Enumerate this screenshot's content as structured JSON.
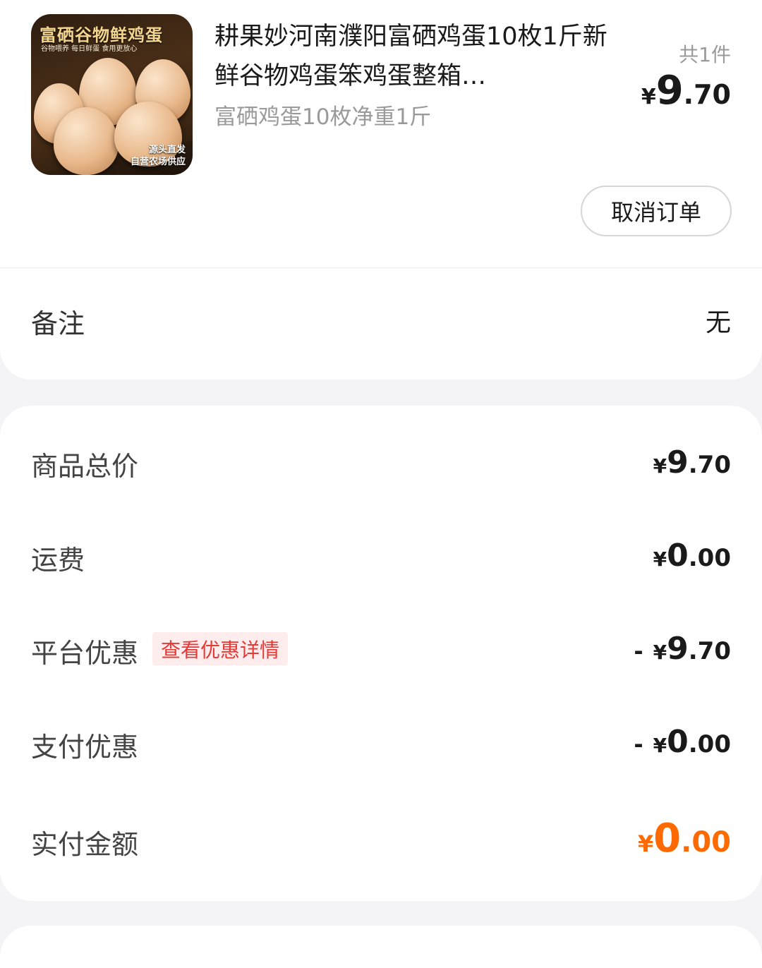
{
  "product": {
    "image": {
      "title": "富硒谷物鲜鸡蛋",
      "subtitle": "谷物喂养  每日鲜蛋  食用更放心",
      "footer_line1": "源头直发",
      "footer_line2": "自营农场供应"
    },
    "title": "耕果妙河南濮阳富硒鸡蛋10枚1斤新鲜谷物鸡蛋笨鸡蛋整箱…",
    "spec": "富硒鸡蛋10枚净重1斤",
    "quantity": "共1件",
    "price": {
      "currency": "¥",
      "integer": "9",
      "decimal": ".70"
    }
  },
  "actions": {
    "cancel_order": "取消订单"
  },
  "remark": {
    "label": "备注",
    "value": "无"
  },
  "summary": {
    "goods_total": {
      "label": "商品总价",
      "currency": "¥",
      "integer": "9",
      "decimal": ".70"
    },
    "shipping": {
      "label": "运费",
      "currency": "¥",
      "integer": "0",
      "decimal": ".00"
    },
    "platform_discount": {
      "label": "平台优惠",
      "tag": "查看优惠详情",
      "minus": "-",
      "currency": "¥",
      "integer": "9",
      "decimal": ".70"
    },
    "payment_discount": {
      "label": "支付优惠",
      "minus": "-",
      "currency": "¥",
      "integer": "0",
      "decimal": ".00"
    },
    "paid_amount": {
      "label": "实付金额",
      "currency": "¥",
      "integer": "0",
      "decimal": ".00"
    }
  },
  "colors": {
    "accent_orange": "#ff6a00",
    "tag_red": "#e53935",
    "tag_bg": "#ffecec",
    "page_bg": "#f4f4f6"
  }
}
